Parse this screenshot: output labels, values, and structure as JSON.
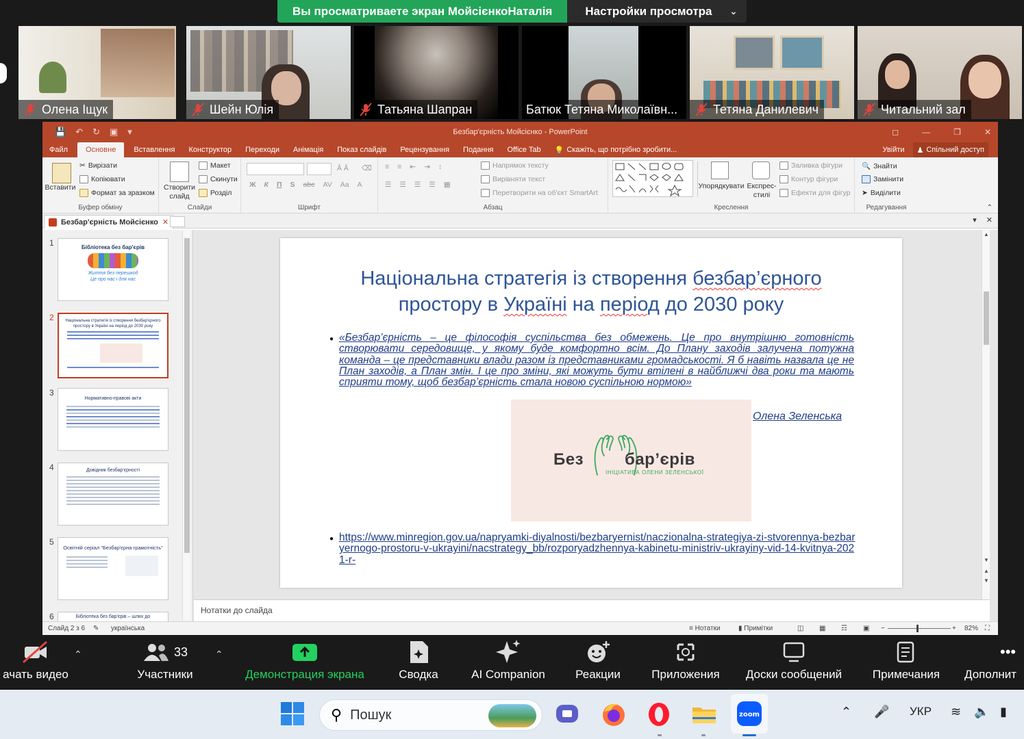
{
  "zoom": {
    "banner": {
      "viewing_text": "Вы просматриваете экран МойсієнкоНаталія",
      "view_options_label": "Настройки просмотра"
    },
    "participants": [
      {
        "name": "Олена Іщук",
        "muted": true
      },
      {
        "name": "Шейн Юлія",
        "muted": true
      },
      {
        "name": "Татьяна Шапран",
        "muted": true
      },
      {
        "name": "Батюк Тетяна Миколаївн...",
        "muted": false
      },
      {
        "name": "Тетяна Данилевич",
        "muted": true
      },
      {
        "name": "Читальний зал",
        "muted": true
      }
    ],
    "toolbar": {
      "video_label": "ачать видео",
      "participants_label": "Участники",
      "participants_count": "33",
      "share_label": "Демонстрация экрана",
      "summary_label": "Сводка",
      "ai_label": "AI Companion",
      "reactions_label": "Реакции",
      "apps_label": "Приложения",
      "whiteboards_label": "Доски сообщений",
      "notes_label": "Примечания",
      "more_label": "Дополнит",
      "accent": "#23d160"
    }
  },
  "powerpoint": {
    "window_title": "Безбар'єрність Мойсієнко - PowerPoint",
    "tabs": [
      "Файл",
      "Основне",
      "Вставлення",
      "Конструктор",
      "Переходи",
      "Анімація",
      "Показ слайдів",
      "Рецензування",
      "Подання",
      "Office Tab"
    ],
    "active_tab": "Основне",
    "tell_me": "Скажіть, що потрібно зробити...",
    "sign_in": "Увійти",
    "share": "Спільний доступ",
    "ribbon": {
      "clipboard": {
        "paste": "Вставити",
        "cut": "Вирізати",
        "copy": "Копіювати",
        "format_painter": "Формат за зразком",
        "group": "Буфер обміну"
      },
      "slides": {
        "new_slide": "Створити слайд",
        "layout": "Макет",
        "reset": "Скинути",
        "section": "Розділ",
        "group": "Слайди"
      },
      "font": {
        "group": "Шрифт",
        "bold": "Ж",
        "italic": "К",
        "underline": "П",
        "strike": "abc"
      },
      "paragraph": {
        "text_direction": "Напрямок тексту",
        "align_text": "Вирівняти текст",
        "smartart": "Перетворити на об'єкт SmartArt",
        "group": "Абзац"
      },
      "drawing": {
        "arrange": "Упорядкувати",
        "quick_styles": "Експрес-стилі",
        "fill": "Заливка фігури",
        "outline": "Контур фігури",
        "effects": "Ефекти для фігур",
        "group": "Креслення"
      },
      "editing": {
        "find": "Знайти",
        "replace": "Замінити",
        "select": "Виділити",
        "group": "Редагування"
      }
    },
    "doc_tab": "Безбар'єрність Мойсієнко",
    "thumbnails": [
      {
        "num": "1",
        "title": "Бібліотека без бар'єрів",
        "sub1": "Життя без перешкод",
        "sub2": "Це про нас і для нас"
      },
      {
        "num": "2",
        "title": "Національна стратегія із створення безбар'єрного простору в Україні на період до 2030 року",
        "active": true
      },
      {
        "num": "3",
        "title": "Нормативно-правові акти"
      },
      {
        "num": "4",
        "title": "Довідник безбар'єрності"
      },
      {
        "num": "5",
        "title": "Освітній серіал \"Безбар'єрна грамотність\""
      },
      {
        "num": "6",
        "title": "Бібліотека без бар'єрів – шлях до"
      }
    ],
    "slide": {
      "title_line1_a": "Національна стратегія із створення ",
      "title_line1_b": "безбар’єрного",
      "title_line2_a": "простору в ",
      "title_line2_b": "Україні",
      "title_line2_c": " на ",
      "title_line2_d": "період",
      "title_line2_e": " до 2030 року",
      "quote": "«Безбар’єрність – це філософія суспільства без обмежень. Це про внутрішню готовність створювати середовище, у якому буде комфортно всім. До Плану заходів залучена потужна команда – це представники влади разом із представниками громадськості. Я б навіть назвала це не План заходів, а План змін. І це про зміни, які можуть бути втілені в найближчі два роки та мають сприяти тому, щоб безбар’єрність стала новою суспільною нормою»",
      "author": "Олена Зеленська",
      "logo_word1": "Без",
      "logo_word2": "бар’єрів",
      "logo_tagline": "ІНІЦІАТИВА ОЛЕНИ ЗЕЛЕНСЬКОЇ",
      "link": "https://www.minregion.gov.ua/napryamki-diyalnosti/bezbaryernist/naczionalna-strategiya-zi-stvorennya-bezbaryernogo-prostoru-v-ukrayini/nacstrategy_bb/rozporyadzhennya-kabinetu-ministriv-ukrayiny-vid-14-kvitnya-2021-r-",
      "title_color": "#2f5597",
      "text_color": "#1f3c88"
    },
    "notes_placeholder": "Нотатки до слайда",
    "status": {
      "slide_counter": "Слайд 2 з 6",
      "language": "українська",
      "notes": "Нотатки",
      "comments": "Примітки",
      "zoom_percent": "82%",
      "zoom_level": 0.46
    },
    "accent": "#b7472a"
  },
  "taskbar": {
    "search_label": "Пошук",
    "lang": "УКР"
  }
}
